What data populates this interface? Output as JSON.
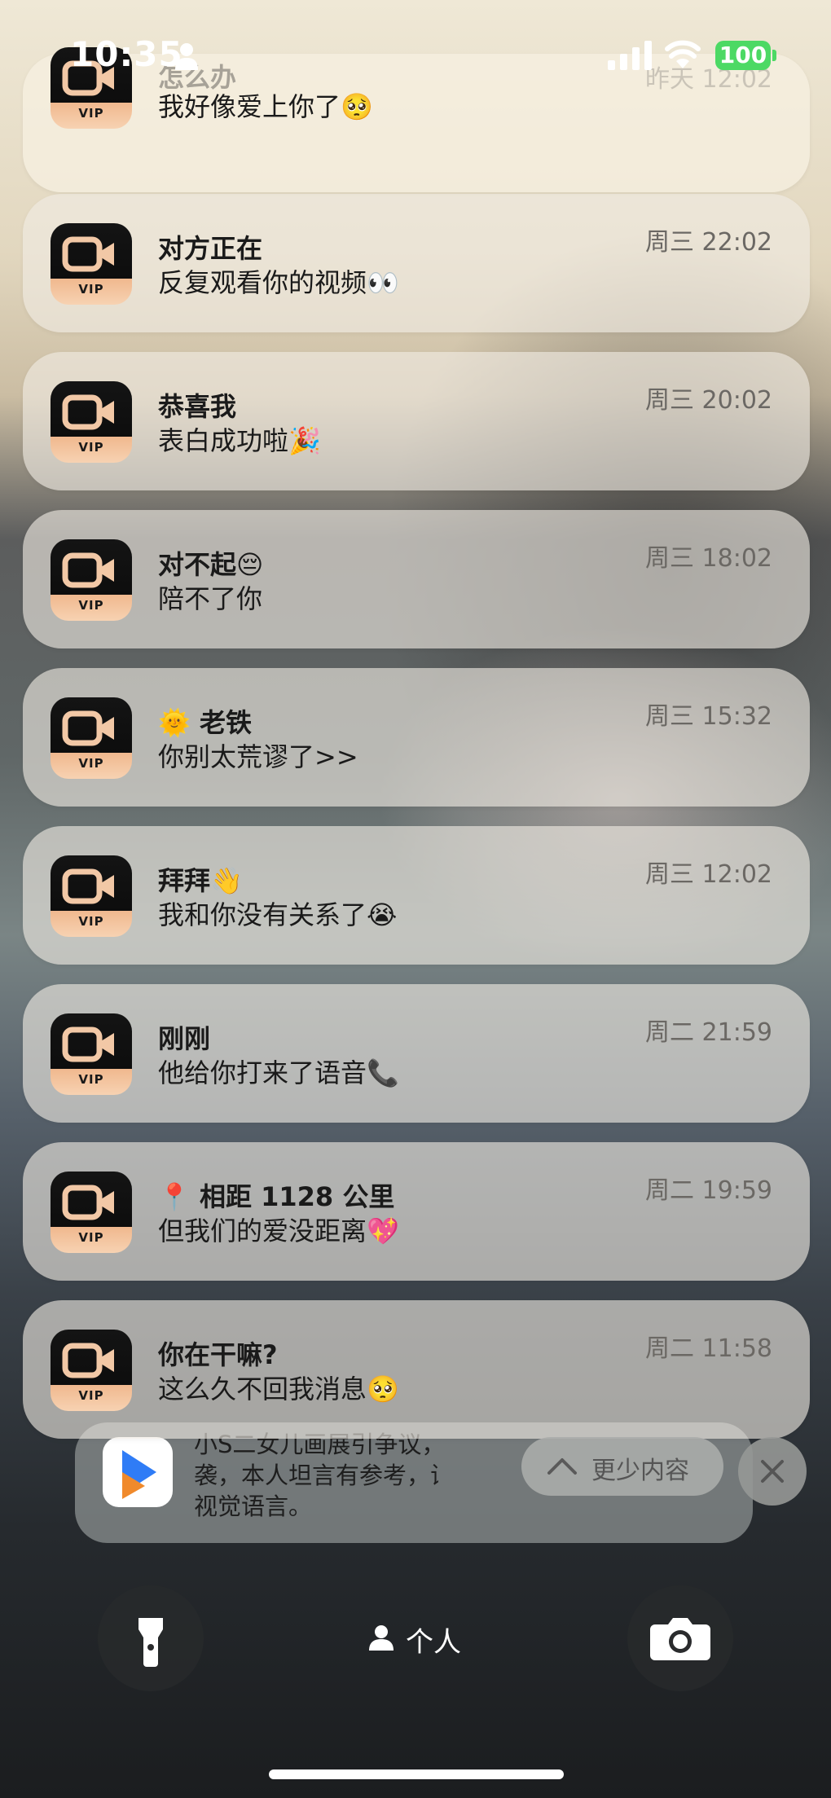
{
  "status_bar": {
    "time": "10:35",
    "battery": "100",
    "icons": [
      "person-icon",
      "cellular-signal-icon",
      "wifi-icon",
      "battery-icon"
    ]
  },
  "app": {
    "name": "video-vip-app",
    "icon_badge": "VIP",
    "icon_colors": {
      "top": "#111111",
      "bottom": "#f5c9a6"
    }
  },
  "notifications": [
    {
      "title": "怎么办",
      "body": "我好像爱上你了🥺",
      "time": "昨天 12:02"
    },
    {
      "title": "对方正在",
      "body": "反复观看你的视频👀",
      "time": "周三 22:02"
    },
    {
      "title": "恭喜我",
      "body": "表白成功啦🎉",
      "time": "周三 20:02"
    },
    {
      "title": "对不起😔",
      "body": "陪不了你",
      "time": "周三 18:02"
    },
    {
      "title": "🌞 老铁",
      "body": "你别太荒谬了>>",
      "time": "周三 15:32"
    },
    {
      "title": "拜拜👋",
      "body": "我和你没有关系了😭",
      "time": "周三 12:02"
    },
    {
      "title": "刚刚",
      "body": "他给你打来了语音📞",
      "time": "周二 21:59"
    },
    {
      "title": "📍 相距 1128 公里",
      "body": "但我们的爱没距离💖",
      "time": "周二 19:59"
    },
    {
      "title": "你在干嘛?",
      "body": "这么久不回我消息🥺",
      "time": "周二 11:58"
    }
  ],
  "stacked_notification": {
    "lines": [
      "小S二女儿画展引争议，艺术风格",
      "袭，本人坦言有参考，试图找到",
      "视觉语言。"
    ],
    "show_less_label": "更少内容"
  },
  "lock_controls": {
    "flashlight": "flashlight-icon",
    "focus_label": "个人",
    "camera": "camera-icon"
  }
}
